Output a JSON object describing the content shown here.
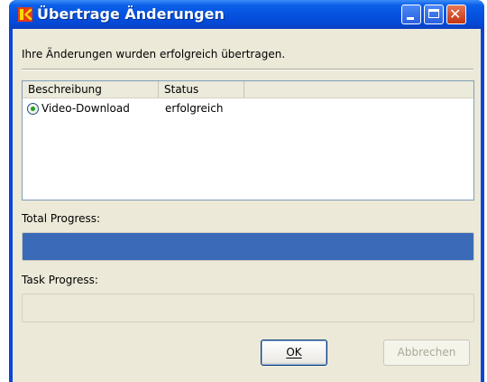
{
  "window": {
    "title": "Übertrage Änderungen",
    "app_icon": "kaspersky-k-icon",
    "controls": [
      "minimize-icon",
      "maximize-icon",
      "close-icon"
    ]
  },
  "message": "Ihre Änderungen wurden erfolgreich übertragen.",
  "list": {
    "columns": [
      "Beschreibung",
      "Status"
    ],
    "rows": [
      {
        "icon": "radio-icon",
        "description": "Video-Download",
        "status": "erfolgreich"
      }
    ]
  },
  "total_progress": {
    "label": "Total Progress:",
    "value_percent": 100
  },
  "task_progress": {
    "label": "Task Progress:",
    "value_percent": 0
  },
  "buttons": {
    "ok": {
      "label": "OK",
      "enabled": true
    },
    "cancel": {
      "label": "Abbrechen",
      "enabled": false
    }
  },
  "colors": {
    "title_bar": "#0553e0",
    "progress_fill": "#3b6bb8",
    "dialog_background": "#ece9d8"
  }
}
